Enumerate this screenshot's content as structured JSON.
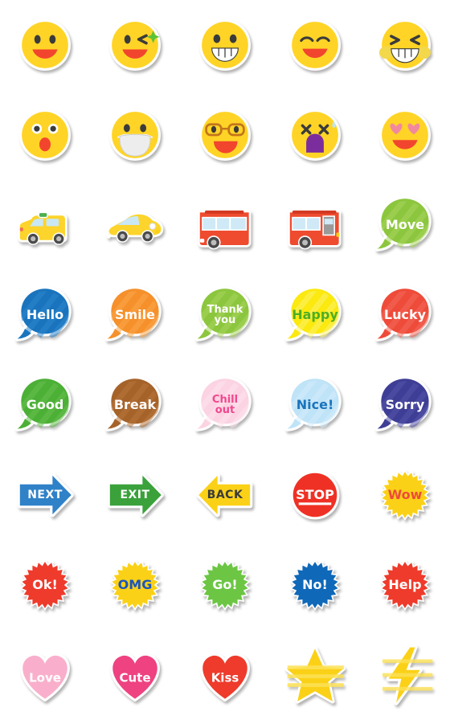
{
  "page": {
    "title": "Emoji Sticker Sheet",
    "background": "#ffffff",
    "columns": 5,
    "rows": 8,
    "cell_size": 112
  },
  "stickers": [
    {
      "id": "smile-face",
      "icon": "smiling-face-icon",
      "label": "",
      "kind": "face",
      "row": 1,
      "col": 1,
      "colors": {
        "base": "#FFD426",
        "accent": "#F2452E",
        "ink": "#3B3B3B"
      }
    },
    {
      "id": "wink-face",
      "icon": "winking-face-icon",
      "label": "",
      "kind": "face",
      "row": 1,
      "col": 2,
      "colors": {
        "base": "#FFD426",
        "accent": "#F2452E",
        "ink": "#3B3B3B",
        "spark": "#5BC236"
      }
    },
    {
      "id": "grin-teeth-face",
      "icon": "grinning-face-icon",
      "label": "",
      "kind": "face",
      "row": 1,
      "col": 3,
      "colors": {
        "base": "#FFD426",
        "accent": "#FFFFFF",
        "ink": "#3B3B3B"
      }
    },
    {
      "id": "happy-eyes-face",
      "icon": "smiling-eyes-face-icon",
      "label": "",
      "kind": "face",
      "row": 1,
      "col": 4,
      "colors": {
        "base": "#FFD426",
        "accent": "#F2452E",
        "ink": "#3B3B3B"
      }
    },
    {
      "id": "squint-grin-face",
      "icon": "squinting-grin-face-icon",
      "label": "",
      "kind": "face",
      "row": 1,
      "col": 5,
      "colors": {
        "base": "#FFD426",
        "accent": "#FFFFFF",
        "ink": "#3B3B3B",
        "blush": "#F3D84B"
      }
    },
    {
      "id": "surprised-face",
      "icon": "surprised-face-icon",
      "label": "",
      "kind": "face",
      "row": 2,
      "col": 1,
      "colors": {
        "base": "#FFD426",
        "accent": "#F2452E",
        "ink": "#3B3B3B"
      }
    },
    {
      "id": "mask-face",
      "icon": "face-with-mask-icon",
      "label": "",
      "kind": "face",
      "row": 2,
      "col": 2,
      "colors": {
        "base": "#FFD426",
        "accent": "#EDEDED",
        "ink": "#3B3B3B"
      }
    },
    {
      "id": "glasses-face",
      "icon": "face-with-glasses-icon",
      "label": "",
      "kind": "face",
      "row": 2,
      "col": 3,
      "colors": {
        "base": "#FFD426",
        "accent": "#F2452E",
        "ink": "#C2761B"
      }
    },
    {
      "id": "dizzy-face",
      "icon": "dizzy-face-icon",
      "label": "",
      "kind": "face",
      "row": 2,
      "col": 4,
      "colors": {
        "base": "#FFD426",
        "accent": "#7B2D9E",
        "ink": "#3B3B3B",
        "drop": "#BFE6F5"
      }
    },
    {
      "id": "heart-eyes-face",
      "icon": "heart-eyes-face-icon",
      "label": "",
      "kind": "face",
      "row": 2,
      "col": 5,
      "colors": {
        "base": "#FFD426",
        "accent": "#F2452E",
        "ink": "#F2889E"
      }
    },
    {
      "id": "taxi",
      "icon": "taxi-icon",
      "label": "",
      "kind": "vehicle",
      "row": 3,
      "col": 1,
      "colors": {
        "base": "#FCD42B",
        "glass": "#C9E7F5",
        "tire": "#3F3F3F",
        "light": "#4CAF50"
      }
    },
    {
      "id": "car",
      "icon": "car-icon",
      "label": "",
      "kind": "vehicle",
      "row": 3,
      "col": 2,
      "colors": {
        "base": "#FCD42B",
        "glass": "#C9E7F5",
        "tire": "#3F3F3F"
      }
    },
    {
      "id": "bus",
      "icon": "bus-icon",
      "label": "",
      "kind": "vehicle",
      "row": 3,
      "col": 3,
      "colors": {
        "base": "#EE4B2F",
        "glass": "#CFE9F7",
        "tire": "#3F3F3F"
      }
    },
    {
      "id": "bus-door",
      "icon": "bus-with-door-icon",
      "label": "",
      "kind": "vehicle",
      "row": 3,
      "col": 4,
      "colors": {
        "base": "#EE4B2F",
        "glass": "#CFE9F7",
        "tire": "#3F3F3F"
      }
    },
    {
      "id": "move",
      "icon": "speech-bubble-icon",
      "label": "Move",
      "kind": "bubble",
      "row": 3,
      "col": 5,
      "colors": {
        "base": "#8CC63E",
        "stripe": "#A8D65C",
        "text": "#FFFFFF"
      }
    },
    {
      "id": "hello",
      "icon": "speech-bubble-icon",
      "label": "Hello",
      "kind": "bubble",
      "row": 4,
      "col": 1,
      "colors": {
        "base": "#1A74BD",
        "stripe": "#2D86CE",
        "text": "#FFFFFF"
      }
    },
    {
      "id": "smile",
      "icon": "speech-bubble-icon",
      "label": "Smile",
      "kind": "bubble",
      "row": 4,
      "col": 2,
      "colors": {
        "base": "#F5902B",
        "stripe": "#FAA64A",
        "text": "#FFFFFF"
      }
    },
    {
      "id": "thank-you",
      "icon": "speech-bubble-icon",
      "label": "Thank you",
      "kind": "bubble",
      "row": 4,
      "col": 3,
      "colors": {
        "base": "#8CC63E",
        "stripe": "#A8D65C",
        "text": "#FFFFFF"
      }
    },
    {
      "id": "happy",
      "icon": "speech-bubble-icon",
      "label": "Happy",
      "kind": "bubble",
      "row": 4,
      "col": 4,
      "colors": {
        "base": "#FBE90F",
        "stripe": "#FDF36B",
        "text": "#4CAF23"
      }
    },
    {
      "id": "lucky",
      "icon": "speech-bubble-icon",
      "label": "Lucky",
      "kind": "bubble",
      "row": 4,
      "col": 5,
      "colors": {
        "base": "#EE4B3A",
        "stripe": "#F46A5A",
        "text": "#FFFFFF"
      }
    },
    {
      "id": "good",
      "icon": "speech-bubble-icon",
      "label": "Good",
      "kind": "bubble",
      "row": 5,
      "col": 1,
      "colors": {
        "base": "#4CAF36",
        "stripe": "#66C04F",
        "text": "#FFFFFF"
      }
    },
    {
      "id": "break",
      "icon": "speech-bubble-icon",
      "label": "Break",
      "kind": "bubble",
      "row": 5,
      "col": 2,
      "colors": {
        "base": "#A5632A",
        "stripe": "#B8763C",
        "text": "#FFFFFF"
      }
    },
    {
      "id": "chill-out",
      "icon": "speech-bubble-icon",
      "label": "Chill out",
      "kind": "bubble",
      "row": 5,
      "col": 3,
      "colors": {
        "base": "#FBD3E2",
        "stripe": "#FDE4EE",
        "text": "#F0488E"
      }
    },
    {
      "id": "nice",
      "icon": "speech-bubble-icon",
      "label": "Nice!",
      "kind": "bubble",
      "row": 5,
      "col": 4,
      "colors": {
        "base": "#BFE3F7",
        "stripe": "#D4EDFB",
        "text": "#1A74BD"
      }
    },
    {
      "id": "sorry",
      "icon": "speech-bubble-icon",
      "label": "Sorry",
      "kind": "bubble",
      "row": 5,
      "col": 5,
      "colors": {
        "base": "#3F3E96",
        "stripe": "#5554AB",
        "text": "#FFFFFF"
      }
    },
    {
      "id": "next",
      "icon": "arrow-right-icon",
      "label": "NEXT",
      "kind": "arrow-r",
      "row": 6,
      "col": 1,
      "colors": {
        "base": "#2F82C8",
        "text": "#FFFFFF"
      }
    },
    {
      "id": "exit",
      "icon": "arrow-right-icon",
      "label": "EXIT",
      "kind": "arrow-r",
      "row": 6,
      "col": 2,
      "colors": {
        "base": "#3AA13B",
        "text": "#FFFFFF"
      }
    },
    {
      "id": "back",
      "icon": "arrow-left-icon",
      "label": "BACK",
      "kind": "arrow-l",
      "row": 6,
      "col": 3,
      "colors": {
        "base": "#FBD117",
        "text": "#3B3B3B"
      }
    },
    {
      "id": "stop",
      "icon": "stop-sign-icon",
      "label": "STOP",
      "kind": "circle",
      "row": 6,
      "col": 4,
      "colors": {
        "base": "#EE3124",
        "text": "#FFFFFF"
      }
    },
    {
      "id": "wow",
      "icon": "starburst-badge-icon",
      "label": "Wow",
      "kind": "burst",
      "row": 6,
      "col": 5,
      "colors": {
        "base": "#FBD117",
        "text": "#EE4B3A"
      }
    },
    {
      "id": "ok",
      "icon": "starburst-badge-icon",
      "label": "Ok!",
      "kind": "burst",
      "row": 7,
      "col": 1,
      "colors": {
        "base": "#EE3B2C",
        "text": "#FFFFFF"
      }
    },
    {
      "id": "omg",
      "icon": "starburst-badge-icon",
      "label": "OMG",
      "kind": "burst",
      "row": 7,
      "col": 2,
      "colors": {
        "base": "#FBD117",
        "text": "#1A56BD"
      }
    },
    {
      "id": "go",
      "icon": "starburst-badge-icon",
      "label": "Go!",
      "kind": "burst",
      "row": 7,
      "col": 3,
      "colors": {
        "base": "#6CC644",
        "text": "#FFFFFF"
      }
    },
    {
      "id": "no",
      "icon": "starburst-badge-icon",
      "label": "No!",
      "kind": "burst",
      "row": 7,
      "col": 4,
      "colors": {
        "base": "#1068B8",
        "text": "#FFFFFF"
      }
    },
    {
      "id": "help",
      "icon": "starburst-badge-icon",
      "label": "Help",
      "kind": "burst",
      "row": 7,
      "col": 5,
      "colors": {
        "base": "#EE3B2C",
        "text": "#FFFFFF"
      }
    },
    {
      "id": "love",
      "icon": "heart-icon",
      "label": "Love",
      "kind": "heart",
      "row": 8,
      "col": 1,
      "colors": {
        "base": "#F9AFCB",
        "text": "#FFFFFF"
      }
    },
    {
      "id": "cute",
      "icon": "heart-icon",
      "label": "Cute",
      "kind": "heart",
      "row": 8,
      "col": 2,
      "colors": {
        "base": "#EE4281",
        "text": "#FFFFFF"
      }
    },
    {
      "id": "kiss",
      "icon": "heart-icon",
      "label": "Kiss",
      "kind": "heart",
      "row": 8,
      "col": 3,
      "colors": {
        "base": "#EE3B2C",
        "text": "#FFFFFF"
      }
    },
    {
      "id": "star",
      "icon": "star-icon",
      "label": "",
      "kind": "star",
      "row": 8,
      "col": 4,
      "colors": {
        "base": "#FBD117",
        "stripe": "#FDE257"
      }
    },
    {
      "id": "lightning",
      "icon": "lightning-bolt-icon",
      "label": "",
      "kind": "bolt",
      "row": 8,
      "col": 5,
      "colors": {
        "base": "#FBD117",
        "stripe": "#FDE257"
      }
    }
  ]
}
